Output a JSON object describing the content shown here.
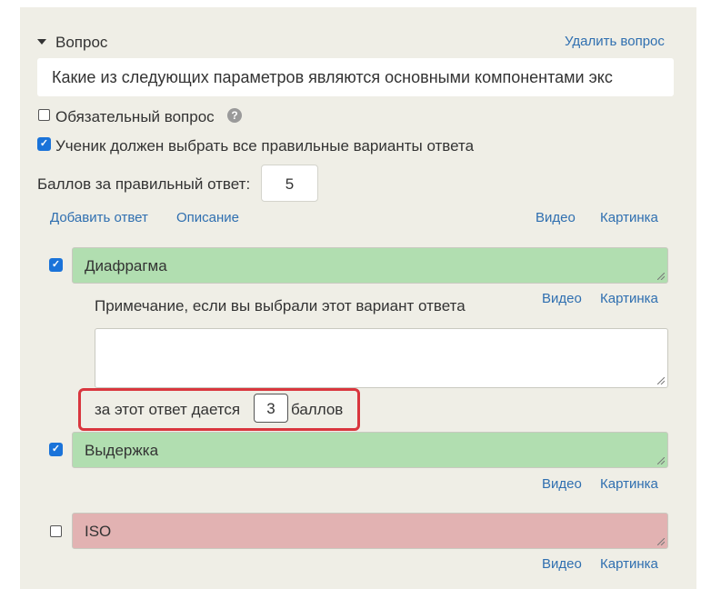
{
  "question": {
    "header_label": "Вопрос",
    "delete_link": "Удалить вопрос",
    "text": "Какие из следующих параметров являются основными компонентами экс",
    "required_label": "Обязательный вопрос",
    "required_checked": false,
    "all_correct_label": "Ученик должен выбрать все правильные варианты ответа",
    "all_correct_checked": true,
    "points_label": "Баллов за правильный ответ:",
    "points_value": "5"
  },
  "actions": {
    "add_answer": "Добавить ответ",
    "description": "Описание",
    "video": "Видео",
    "picture": "Картинка"
  },
  "answers": [
    {
      "text": "Диафрагма",
      "checked": true,
      "status_color": "#b1deb0",
      "note_label": "Примечание, если вы выбрали этот вариант ответа",
      "note_video": "Видео",
      "note_picture": "Картинка",
      "note_value": "",
      "score_prefix": "за этот ответ дается",
      "score_value": "3",
      "score_suffix": "баллов"
    },
    {
      "text": "Выдержка",
      "checked": true,
      "status_color": "#b1deb0",
      "video": "Видео",
      "picture": "Картинка"
    },
    {
      "text": "ISO",
      "checked": false,
      "status_color": "#e2b2b2",
      "video": "Видео",
      "picture": "Картинка"
    }
  ],
  "colors": {
    "panel_bg": "#efeee6",
    "link": "#2f6fb0",
    "checkbox_accent": "#1a73d9",
    "highlight": "#d9363e"
  }
}
